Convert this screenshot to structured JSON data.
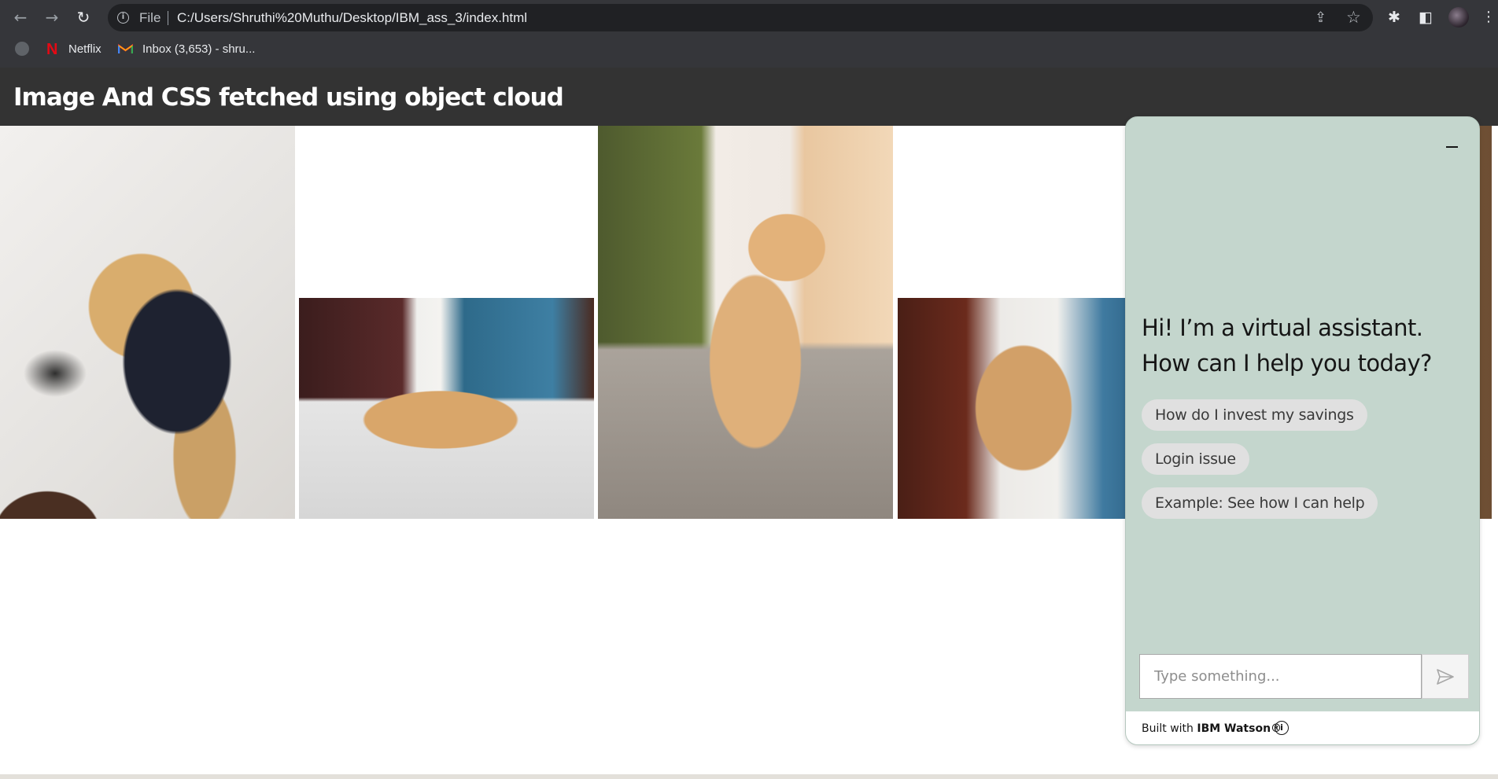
{
  "browser": {
    "nav": {
      "back_icon": "←",
      "forward_icon": "→",
      "reload_icon": "↻"
    },
    "omnibox": {
      "scheme_label": "File",
      "url": "C:/Users/Shruthi%20Muthu/Desktop/IBM_ass_3/index.html"
    },
    "toolbar_icons": [
      "share-icon",
      "bookmark-star-icon",
      "extensions-icon",
      "side-panel-icon",
      "profile-avatar",
      "menu-icon"
    ],
    "bookmarks": [
      {
        "icon": "netflix-icon",
        "icon_glyph": "N",
        "label": "Netflix"
      },
      {
        "icon": "gmail-icon",
        "label": "Inbox (3,653) - shru..."
      }
    ]
  },
  "page": {
    "title": "Image And CSS fetched using object cloud",
    "photos": [
      "dog-photo-1",
      "dog-photo-2",
      "dog-photo-3",
      "dog-photo-4",
      "dog-photo-5"
    ]
  },
  "chat": {
    "greeting": "Hi! I’m a virtual assistant. How can I help you today?",
    "suggestions": [
      "How do I invest my savings",
      "Login issue",
      "Example: See how I can help"
    ],
    "input_placeholder": "Type something...",
    "footer_prefix": "Built with ",
    "footer_brand": "IBM Watson®",
    "colors": {
      "panel_bg": "#c4d6cd",
      "chip_bg": "#e0e0e0"
    }
  }
}
